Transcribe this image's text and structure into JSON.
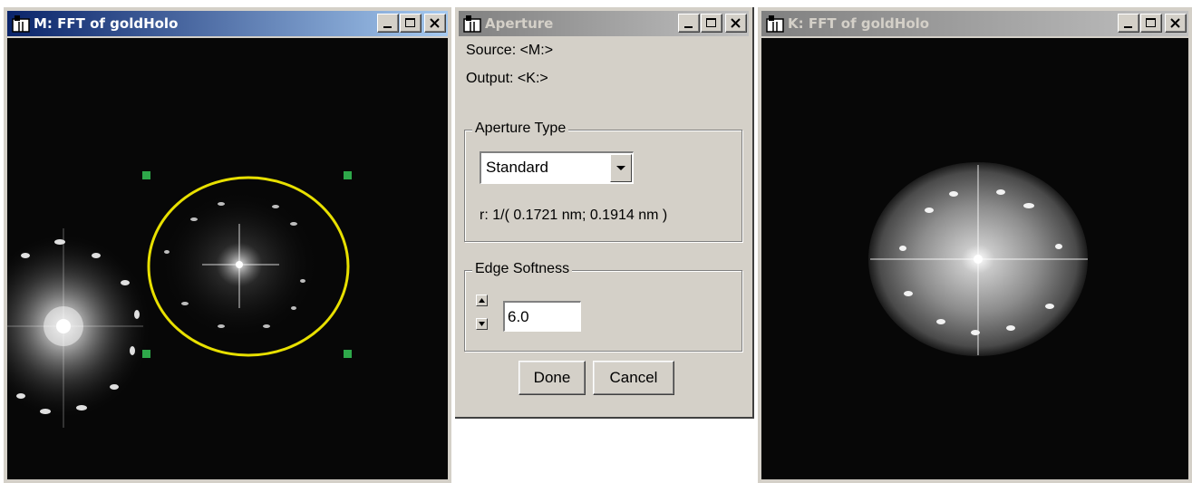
{
  "windows": {
    "fft_source": {
      "title": "M: FFT of goldHolo",
      "buttons": {
        "minimize": "minimize",
        "maximize": "maximize",
        "close": "close"
      }
    },
    "aperture_dialog": {
      "title": "Aperture",
      "source_label": "Source: <M:>",
      "output_label": "Output: <K:>",
      "aperture_type": {
        "legend": "Aperture Type",
        "selected": "Standard",
        "radius_text": "r:  1/( 0.1721 nm; 0.1914 nm )"
      },
      "edge_softness": {
        "legend": "Edge Softness",
        "value": "6.0"
      },
      "done_label": "Done",
      "cancel_label": "Cancel"
    },
    "fft_result": {
      "title": "K: FFT of goldHolo"
    }
  },
  "colors": {
    "active_title_start": "#0a246a",
    "active_title_end": "#a6caf0",
    "inactive_title_start": "#808080",
    "inactive_title_end": "#c0c0c0",
    "window_face": "#d4d0c8",
    "image_background": "#070707",
    "roi_ellipse": "#e8e000",
    "roi_handles": "#2ea84a"
  },
  "icons": [
    "app-window-icon",
    "minimize-icon",
    "maximize-icon",
    "close-icon",
    "dropdown-arrow-icon",
    "spin-up-icon",
    "spin-down-icon"
  ]
}
